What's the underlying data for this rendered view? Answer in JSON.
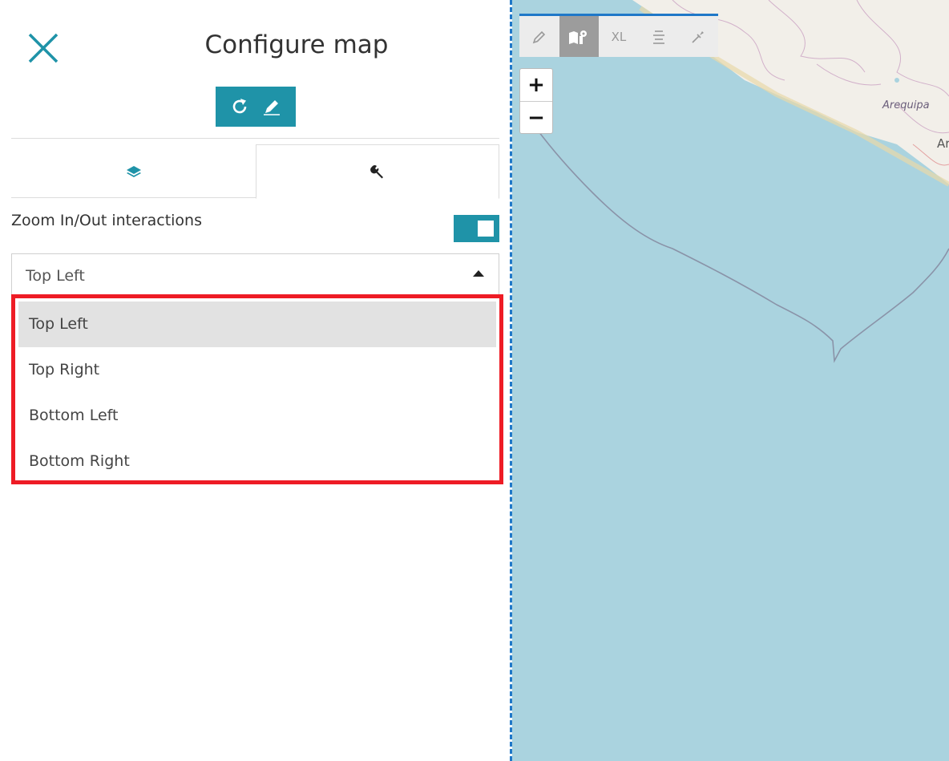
{
  "panel": {
    "title": "Configure map",
    "zoom_label": "Zoom In/Out interactions",
    "toggle_on": true,
    "select": {
      "value": "Top Left",
      "options": [
        {
          "label": "Top Left",
          "selected": true
        },
        {
          "label": "Top Right",
          "selected": false
        },
        {
          "label": "Bottom Left",
          "selected": false
        },
        {
          "label": "Bottom Right",
          "selected": false
        }
      ]
    },
    "icons": {
      "close": "close-icon",
      "refresh": "refresh-icon",
      "edit": "pencil-icon",
      "layers_tab": "layers-icon",
      "settings_tab": "wrench-icon",
      "caret": "caret-up-icon"
    }
  },
  "map": {
    "toolbar": {
      "items": [
        {
          "name": "edit-tool",
          "icon": "pencil-icon",
          "label": ""
        },
        {
          "name": "map-settings-tool",
          "icon": "map-gear-icon",
          "label": "",
          "active": true
        },
        {
          "name": "size-tool",
          "icon": "size-icon",
          "label": "XL"
        },
        {
          "name": "align-tool",
          "icon": "align-icon",
          "label": ""
        },
        {
          "name": "eyedropper-tool",
          "icon": "eyedropper-icon",
          "label": ""
        }
      ]
    },
    "zoom": {
      "in": "+",
      "out": "−"
    },
    "labels": {
      "city1": "Arequipa",
      "city2": "Are"
    }
  },
  "colors": {
    "accent": "#1f93a8",
    "highlight_border": "#ee1c25",
    "water": "#aad3df",
    "land": "#f2efe9",
    "split_line": "#1f78c8"
  }
}
